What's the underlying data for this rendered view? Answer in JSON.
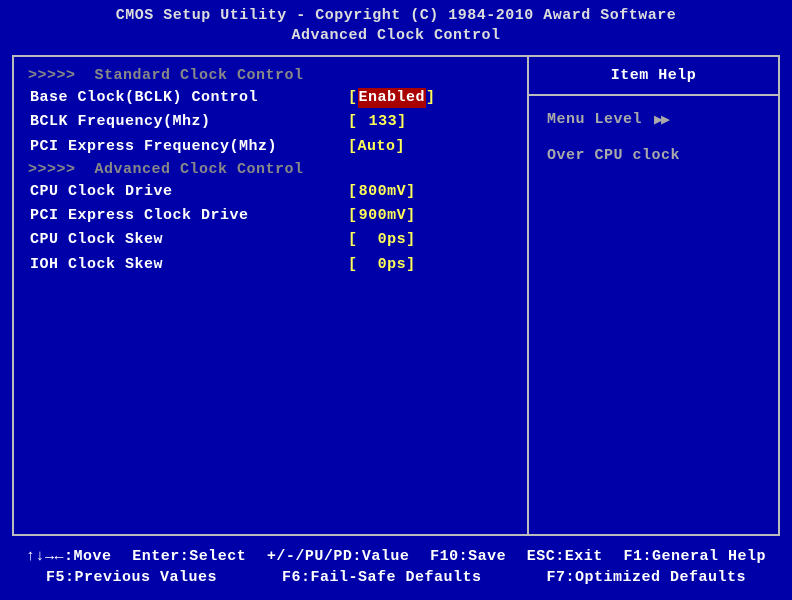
{
  "header": {
    "title": "CMOS Setup Utility - Copyright (C) 1984-2010 Award Software",
    "subtitle": "Advanced Clock Control"
  },
  "sections": {
    "head1_marker": ">>>>>",
    "head1": "Standard Clock Control",
    "head2_marker": ">>>>>",
    "head2": "Advanced Clock Control"
  },
  "settings": {
    "bclk_control": {
      "label": "Base Clock(BCLK) Control",
      "value": "Enabled"
    },
    "bclk_freq": {
      "label": "BCLK Frequency(Mhz)",
      "value": "133"
    },
    "pcie_freq": {
      "label": "PCI Express Frequency(Mhz)",
      "value": "Auto"
    },
    "cpu_drive": {
      "label": "CPU Clock Drive",
      "value": "800mV"
    },
    "pcie_drive": {
      "label": "PCI Express Clock Drive",
      "value": "900mV"
    },
    "cpu_skew": {
      "label": "CPU Clock Skew",
      "value": "0ps"
    },
    "ioh_skew": {
      "label": "IOH Clock Skew",
      "value": "0ps"
    }
  },
  "help": {
    "title": "Item Help",
    "menu_level": "Menu Level",
    "menu_level_marker": "▶▶",
    "desc": "Over CPU clock"
  },
  "footer": {
    "move": "↑↓→←:Move",
    "select": "Enter:Select",
    "value": "+/-/PU/PD:Value",
    "save": "F10:Save",
    "exit": "ESC:Exit",
    "help_key": "F1:General Help",
    "prev": "F5:Previous Values",
    "failsafe": "F6:Fail-Safe Defaults",
    "optimized": "F7:Optimized Defaults"
  }
}
